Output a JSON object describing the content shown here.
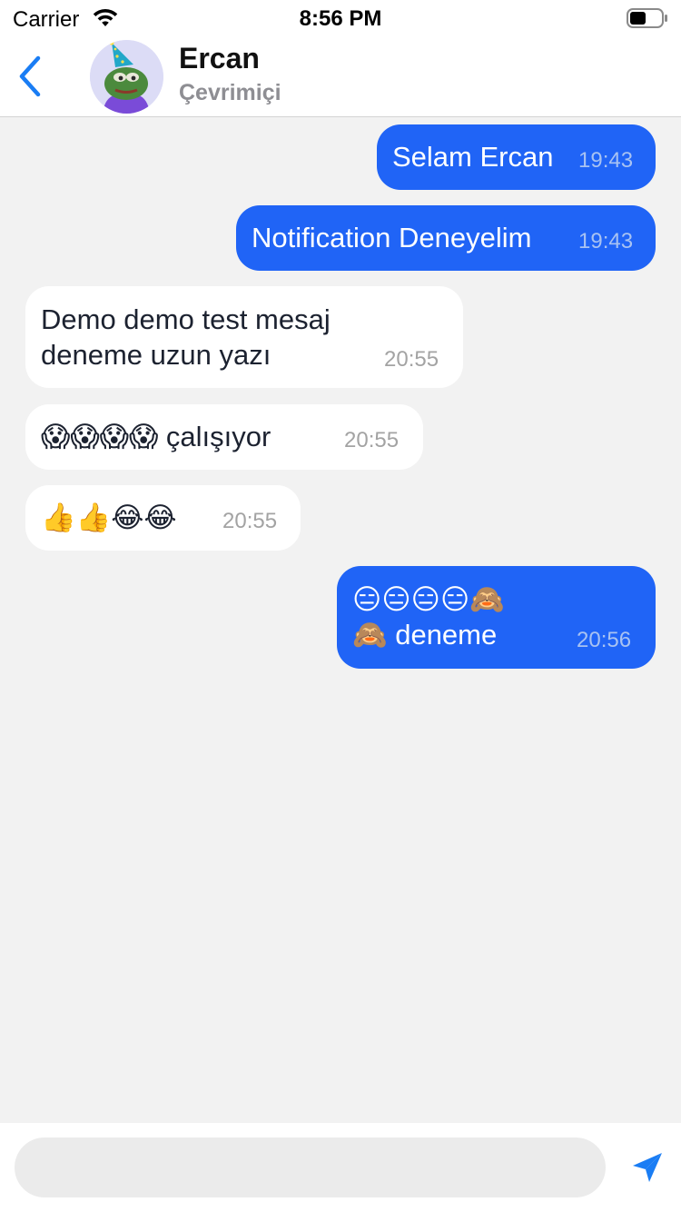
{
  "status_bar": {
    "carrier": "Carrier",
    "time": "8:56 PM",
    "wifi_icon": "wifi-icon",
    "battery_icon": "battery-icon"
  },
  "header": {
    "back_icon": "chevron-left-icon",
    "avatar_icon": "frog-party-hat-avatar",
    "name": "Ercan",
    "status": "Çevrimiçi"
  },
  "messages": [
    {
      "direction": "outgoing",
      "text": "Selam Ercan",
      "time": "19:43"
    },
    {
      "direction": "outgoing",
      "text": "Notification Deneyelim",
      "time": "19:43"
    },
    {
      "direction": "incoming",
      "text": "Demo demo test mesaj\ndeneme uzun yazı",
      "time": "20:55"
    },
    {
      "direction": "incoming",
      "text": "😱😱😱😱 çalışıyor",
      "time": "20:55"
    },
    {
      "direction": "incoming",
      "text": "👍👍😂😂",
      "time": "20:55"
    },
    {
      "direction": "outgoing",
      "text": "😑😑😑😑🙈\n🙈 deneme",
      "time": "20:56"
    }
  ],
  "composer": {
    "placeholder": "",
    "value": "",
    "send_icon": "paper-plane-send-icon"
  },
  "colors": {
    "accent": "#2064f6",
    "outgoing_bubble": "#2064f6",
    "incoming_bubble": "#ffffff",
    "chat_background": "#f2f2f2",
    "status_gray": "#8e8e93",
    "send_icon": "#1a7df4"
  }
}
